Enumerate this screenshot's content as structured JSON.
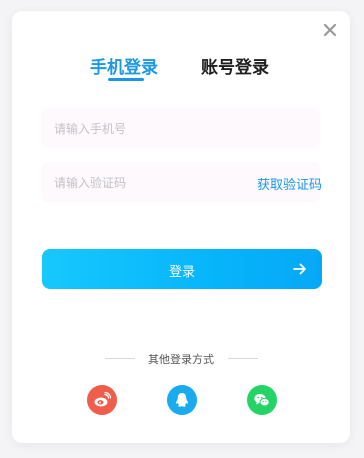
{
  "dialog": {
    "tabs": [
      {
        "label": "手机登录",
        "active": true
      },
      {
        "label": "账号登录",
        "active": false
      }
    ],
    "phone_field": {
      "placeholder": "请输入手机号",
      "value": ""
    },
    "code_field": {
      "placeholder": "请输入验证码",
      "value": ""
    },
    "get_code_label": "获取验证码",
    "login_button_label": "登录",
    "other_login_label": "其他登录方式",
    "social_icons": [
      {
        "name": "weibo-icon",
        "color": "#f05d4a"
      },
      {
        "name": "qq-icon",
        "color": "#1aaaf0"
      },
      {
        "name": "wechat-icon",
        "color": "#24d466"
      }
    ],
    "colors": {
      "accent": "#1a98e6",
      "button_gradient_start": "#17c8fc",
      "button_gradient_end": "#06a8f6",
      "input_background": "#fdf9fd"
    }
  }
}
